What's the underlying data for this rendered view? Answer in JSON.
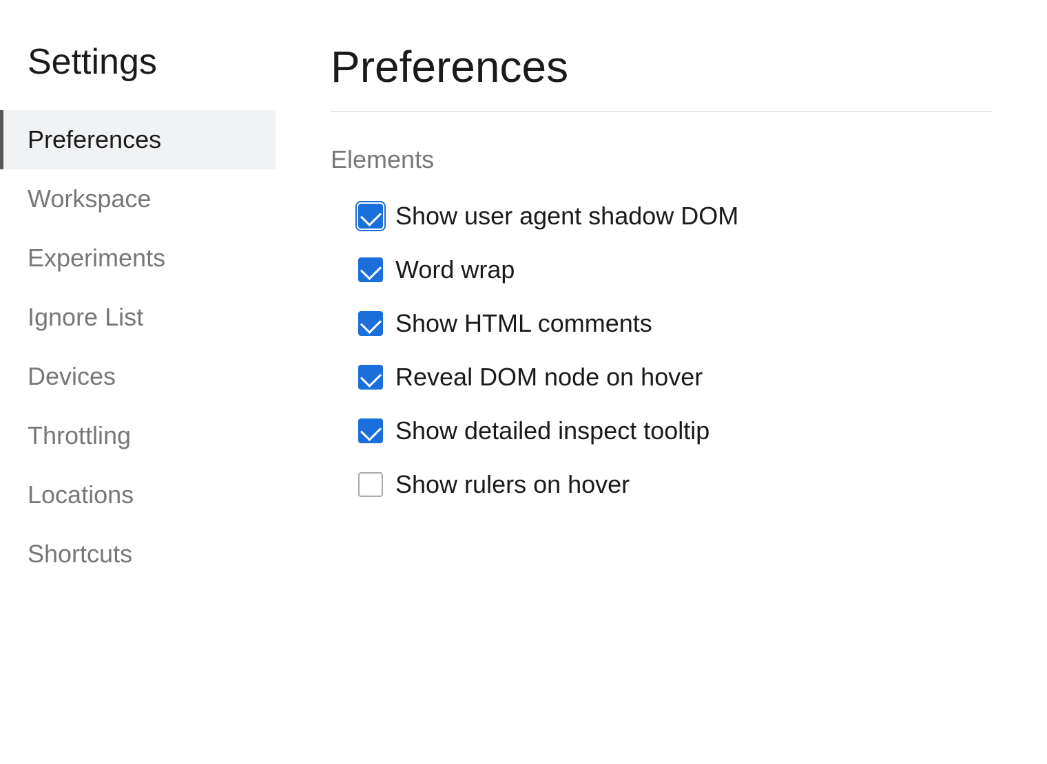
{
  "sidebar": {
    "title": "Settings",
    "items": [
      {
        "id": "preferences",
        "label": "Preferences",
        "active": true
      },
      {
        "id": "workspace",
        "label": "Workspace",
        "active": false
      },
      {
        "id": "experiments",
        "label": "Experiments",
        "active": false
      },
      {
        "id": "ignore-list",
        "label": "Ignore List",
        "active": false
      },
      {
        "id": "devices",
        "label": "Devices",
        "active": false
      },
      {
        "id": "throttling",
        "label": "Throttling",
        "active": false
      },
      {
        "id": "locations",
        "label": "Locations",
        "active": false
      },
      {
        "id": "shortcuts",
        "label": "Shortcuts",
        "active": false
      }
    ]
  },
  "main": {
    "title": "Preferences",
    "section": "Elements",
    "checkboxes": [
      {
        "id": "shadow-dom",
        "label": "Show user agent shadow DOM",
        "checked": true,
        "border": true
      },
      {
        "id": "word-wrap",
        "label": "Word wrap",
        "checked": true,
        "border": false
      },
      {
        "id": "html-comments",
        "label": "Show HTML comments",
        "checked": true,
        "border": false
      },
      {
        "id": "reveal-dom",
        "label": "Reveal DOM node on hover",
        "checked": true,
        "border": false
      },
      {
        "id": "inspect-tooltip",
        "label": "Show detailed inspect tooltip",
        "checked": true,
        "border": false
      },
      {
        "id": "rulers",
        "label": "Show rulers on hover",
        "checked": false,
        "border": false
      }
    ]
  }
}
